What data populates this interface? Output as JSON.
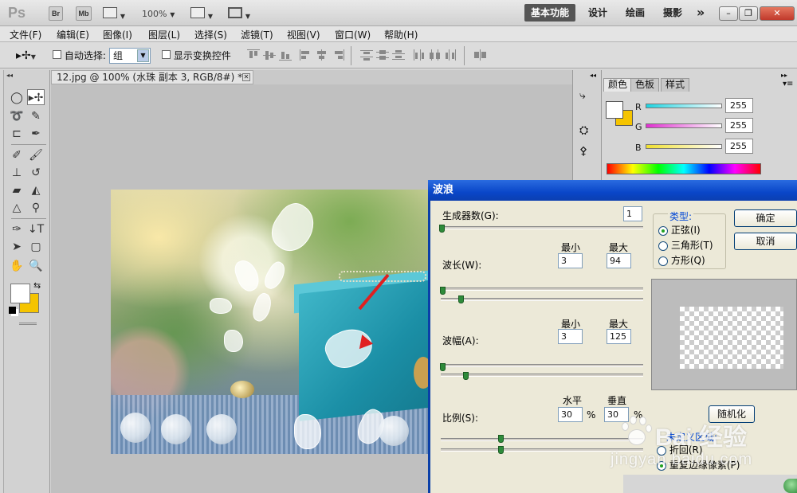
{
  "app": {
    "logo": "Ps",
    "bridge": "Br",
    "minibridge": "Mb",
    "zoom": "100%",
    "workspaces": [
      "基本功能",
      "设计",
      "绘画",
      "摄影"
    ],
    "more": "»"
  },
  "menu": [
    "文件(F)",
    "编辑(E)",
    "图像(I)",
    "图层(L)",
    "选择(S)",
    "滤镜(T)",
    "视图(V)",
    "窗口(W)",
    "帮助(H)"
  ],
  "options": {
    "auto_select": "自动选择:",
    "auto_select_value": "组",
    "show_transform": "显示变换控件"
  },
  "document": {
    "tab_title": "12.jpg @ 100% (水珠 副本 3, RGB/8#) *"
  },
  "panels": {
    "tabs": [
      "颜色",
      "色板",
      "样式"
    ],
    "channels": [
      {
        "label": "R",
        "value": "255",
        "color": "#1fd3e0"
      },
      {
        "label": "G",
        "value": "255",
        "color": "#e030d0"
      },
      {
        "label": "B",
        "value": "255",
        "color": "#f0e030"
      }
    ]
  },
  "dialog": {
    "title": "波浪",
    "generators_label": "生成器数(G):",
    "generators_value": "1",
    "min_label": "最小",
    "max_label": "最大",
    "wavelength_label": "波长(W):",
    "wavelength_min": "3",
    "wavelength_max": "94",
    "amplitude_label": "波幅(A):",
    "amplitude_min": "3",
    "amplitude_max": "125",
    "scale_label": "比例(S):",
    "horizontal_label": "水平",
    "vertical_label": "垂直",
    "scale_h": "30",
    "scale_v": "30",
    "percent": "%",
    "type_label": "类型:",
    "types": [
      "正弦(I)",
      "三角形(T)",
      "方形(Q)"
    ],
    "selected_type": "正弦(I)",
    "ok": "确定",
    "cancel": "取消",
    "randomize": "随机化",
    "undefined_label": "未定义区域:",
    "wrap_label": "折回(R)",
    "repeat_label": "重复边缘像素(P)"
  },
  "watermark": {
    "text": "Bai 经验",
    "url": "jingyan.baidu.com"
  }
}
